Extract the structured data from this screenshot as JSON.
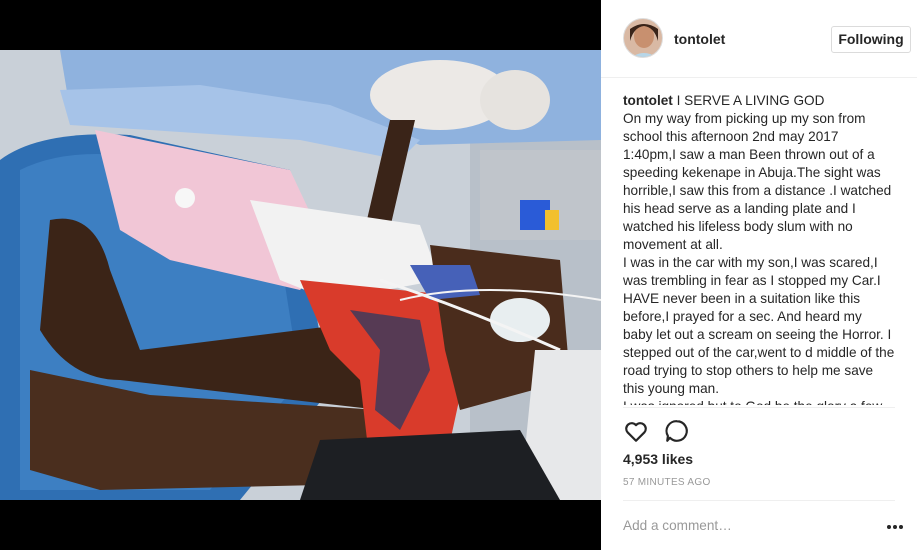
{
  "post": {
    "username": "tontolet",
    "follow_button": "Following",
    "caption_user": "tontolet",
    "caption_text": " I SERVE A LIVING GOD\nOn my way from picking up my son from school this afternoon 2nd may 2017 1:40pm,I saw a man Been thrown out of a speeding kekenape in Abuja.The sight was horrible,I saw this from a distance .I watched his head serve as a landing plate and I watched his lifeless body slum with no movement at all.\nI was in the car with my son,I was scared,I was trembling in fear as I stopped my Car.I HAVE never been in a suitation like this before,I prayed for a sec. And heard my baby let out a scream on seeing the Horror. I stepped out of the car,went to d middle of the road trying to stop others to help me save this young man.\nI was ignored but to God be the glory a few",
    "likes": "4,953 likes",
    "timestamp": "57 MINUTES AGO",
    "comment_placeholder": "Add a comment…"
  },
  "icons": {
    "like": "heart-icon",
    "comment": "speech-bubble-icon",
    "more": "ellipsis-icon"
  },
  "colors": {
    "text": "#262626",
    "muted": "#999999",
    "border": "#dbdbdb",
    "divider": "#efefef"
  }
}
